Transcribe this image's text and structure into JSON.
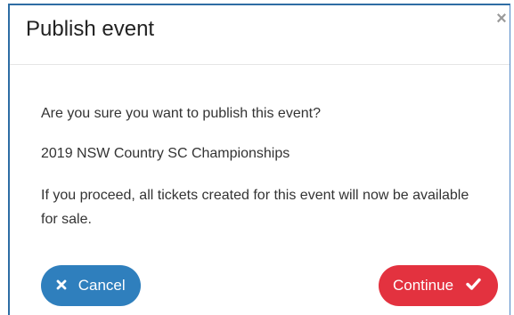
{
  "dialog": {
    "title": "Publish event",
    "close_glyph": "×",
    "question": "Are you sure you want to publish this event?",
    "event_name": "2019 NSW Country SC Championships",
    "message": "If you proceed, all tickets created for this event will now be available for sale."
  },
  "buttons": {
    "cancel_label": "Cancel",
    "cancel_icon": "times-icon",
    "continue_label": "Continue",
    "continue_icon": "check-icon"
  },
  "colors": {
    "cancel_bg": "#2f7fbd",
    "continue_bg": "#e3323f",
    "border_accent": "#2e6da4"
  }
}
